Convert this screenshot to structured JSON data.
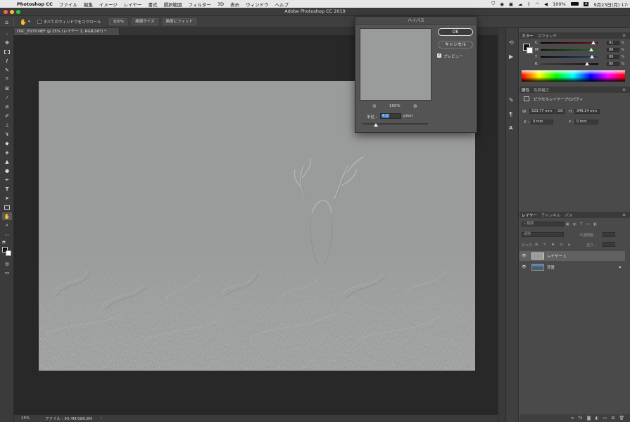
{
  "menubar": {
    "app_name": "Photoshop CC",
    "items": [
      "ファイル",
      "編集",
      "イメージ",
      "レイヤー",
      "書式",
      "選択範囲",
      "フィルター",
      "3D",
      "表示",
      "ウィンドウ",
      "ヘルプ"
    ],
    "battery": "100%",
    "lang": "A",
    "datetime": "9月23日(月) 17:"
  },
  "window": {
    "title": "Adobe Photoshop CC 2019"
  },
  "options_bar": {
    "scroll_all_label": "すべてのウィンドウをスクロール",
    "zoom_btn": "100%",
    "fit_screen_btn": "画面サイズ",
    "fill_screen_btn": "画面にフィット"
  },
  "document": {
    "tab_label": "DSC_8378.NEF @ 25% (レイヤー 1, RGB/16*) *"
  },
  "status_bar": {
    "zoom": "25%",
    "file_info": "ファイル : 93.4M/186.8M",
    "arrow": "›"
  },
  "dialog": {
    "title": "ハイパス",
    "ok": "OK",
    "cancel": "キャンセル",
    "preview_label": "プレビュー",
    "preview_checked": true,
    "preview_zoom": "100%",
    "radius_label": "半径 :",
    "radius_value": "4.0",
    "radius_unit": "pixel"
  },
  "color_panel": {
    "tabs": [
      "カラー",
      "スウォッチ"
    ],
    "channels": [
      {
        "label": "C",
        "value": "91",
        "unit": "%",
        "level": 0.91,
        "grad_from": "#0a0000",
        "grad_to": "#6a0f0f"
      },
      {
        "label": "M",
        "value": "88",
        "unit": "%",
        "level": 0.88,
        "grad_from": "#001a00",
        "grad_to": "#1b6b2a"
      },
      {
        "label": "Y",
        "value": "89",
        "unit": "%",
        "level": 0.89,
        "grad_from": "#000010",
        "grad_to": "#233d78"
      },
      {
        "label": "K",
        "value": "80",
        "unit": "%",
        "level": 0.8,
        "grad_from": "#3a3a3a",
        "grad_to": "#0b0b0b"
      }
    ]
  },
  "properties_panel": {
    "tabs": [
      "属性",
      "色調補正"
    ],
    "type_label": "ピクセルレイヤープロパティ",
    "w_label": "W :",
    "w_value": "523.77 mm",
    "link_label": "GO",
    "h_label": "H :",
    "h_value": "349.14 mm",
    "x_label": "X :",
    "x_value": "0 mm",
    "y_label": "Y :",
    "y_value": "0 mm"
  },
  "layers_panel": {
    "tabs": [
      "レイヤー",
      "チャンネル",
      "パス"
    ],
    "search_placeholder": "種類",
    "blend_mode": "通常",
    "opacity_label": "不透明度 :",
    "lock_label": "ロック :",
    "fill_label": "塗り :",
    "layers": [
      {
        "name": "レイヤー 1",
        "selected": true,
        "locked": false
      },
      {
        "name": "背景",
        "selected": false,
        "locked": true
      }
    ]
  },
  "colors": {
    "canvas_bg": "#282828",
    "image_gray": "#9a9c9b",
    "ok_blue": "#3f74c6"
  }
}
